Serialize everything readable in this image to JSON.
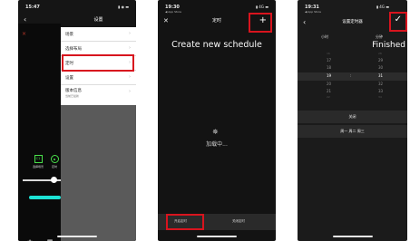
{
  "phone1": {
    "status_time": "15:47",
    "status_icons": "▮ ◉ ▬",
    "back_glyph": "‹",
    "title": "设置",
    "close_glyph": "×",
    "menu_items": [
      {
        "label": "场景"
      },
      {
        "label": "选择布局"
      },
      {
        "label": "定时"
      },
      {
        "label": "设置"
      },
      {
        "label": "版本信息",
        "sub": "当前已最新"
      }
    ],
    "chevron": "›",
    "left_icons": [
      {
        "label": "选择场景"
      },
      {
        "label": "定时"
      }
    ],
    "bottom_icons": [
      {
        "label": "场景"
      },
      {
        "label": "设置"
      }
    ],
    "accent": "#1de2d4",
    "highlight_color": "#d8141e"
  },
  "phone2": {
    "status_time": "19:30",
    "status_sub": "◀ App Store",
    "status_icons": "▮ 4G ▬",
    "close_glyph": "✕",
    "title": "定时",
    "plus_glyph": "+",
    "heading": "Create new schedule",
    "spinner_glyph": "✵",
    "loading_text": "加载中...",
    "tab_left": "开启定时",
    "tab_right": "关闭定时"
  },
  "phone3": {
    "status_time": "19:31",
    "status_sub": "◀ App Store",
    "status_icons": "▮ 4G ▬",
    "back_glyph": "‹",
    "title": "设置定时器",
    "check_glyph": "✓",
    "col_hour": "小时",
    "col_minute": "分钟",
    "finished": "Finished",
    "hours": [
      "16",
      "17",
      "18",
      "19",
      "20",
      "21",
      "22"
    ],
    "minutes": [
      "28",
      "29",
      "30",
      "31",
      "32",
      "33",
      "34"
    ],
    "separator": ":",
    "row_off": "关闭",
    "row_days": "周一 周二 周三"
  }
}
